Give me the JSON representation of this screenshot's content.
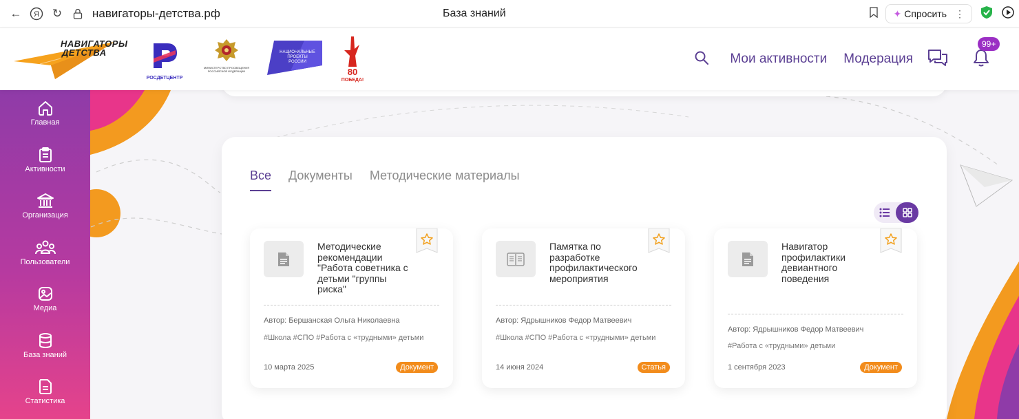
{
  "browser": {
    "url": "навигаторы-детства.рф",
    "title": "База знаний",
    "ask_label": "Спросить"
  },
  "header": {
    "logo_text_1": "НАВИГАТОРЫ",
    "logo_text_2": "ДЕТСТВА",
    "partner_1": "РОСДЕТЦЕНТР",
    "partner_2": "МИНИСТЕРСТВО ПРОСВЕЩЕНИЯ РОССИЙСКОЙ ФЕДЕРАЦИИ",
    "partner_3": "НАЦИОНАЛЬНЫЕ ПРОЕКТЫ РОССИИ",
    "partner_4": "80 ПОБЕДА!",
    "nav": [
      "Мои активности",
      "Модерация"
    ],
    "notifications": "99+"
  },
  "sidebar": {
    "items": [
      {
        "label": "Главная",
        "icon": "home-icon"
      },
      {
        "label": "Активности",
        "icon": "clipboard-icon"
      },
      {
        "label": "Организация",
        "icon": "building-icon"
      },
      {
        "label": "Пользователи",
        "icon": "users-icon"
      },
      {
        "label": "Медиа",
        "icon": "media-icon"
      },
      {
        "label": "База знаний",
        "icon": "database-icon"
      },
      {
        "label": "Статистика",
        "icon": "document-icon"
      }
    ]
  },
  "main": {
    "tabs": [
      "Все",
      "Документы",
      "Методические материалы"
    ],
    "active_tab": "Все",
    "cards": [
      {
        "title": "Методические рекомендации \"Работа советника с детьми \"группы риска\"",
        "author": "Автор: Бершанская Ольга Николаевна",
        "tags": "#Школа #СПО #Работа с «трудными» детьми",
        "date": "10 марта 2025",
        "type": "Документ",
        "icon": "document-icon"
      },
      {
        "title": "Памятка по разработке профилактического мероприятия",
        "author": "Автор: Ядрышников Федор Матвеевич",
        "tags": "#Школа #СПО #Работа с «трудными» детьми",
        "date": "14 июня 2024",
        "type": "Статья",
        "icon": "book-icon"
      },
      {
        "title": "Навигатор профилактики девиантного поведения",
        "author": "Автор: Ядрышников Федор Матвеевич",
        "tags": "#Работа с «трудными» детьми",
        "date": "1 сентября 2023",
        "type": "Документ",
        "icon": "document-icon"
      }
    ]
  },
  "colors": {
    "accent": "#5b3f93",
    "badge": "#f28c1c",
    "sidebar_top": "#8f3ba8",
    "sidebar_bottom": "#e5438b"
  }
}
